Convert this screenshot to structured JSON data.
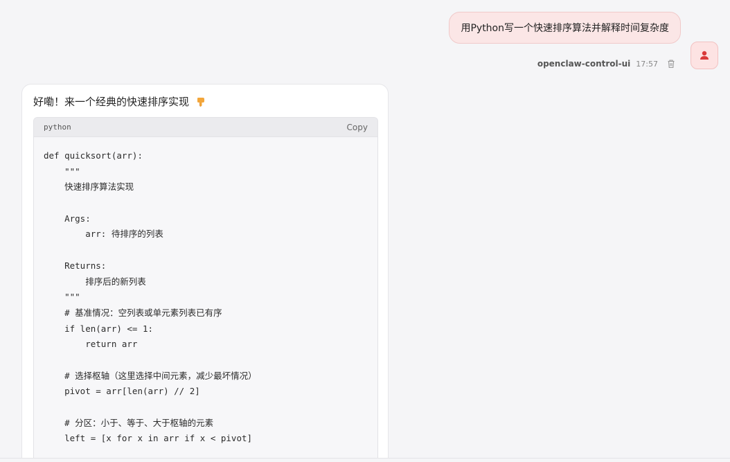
{
  "user_message": {
    "text": "用Python写一个快速排序算法并解释时间复杂度",
    "sender": "openclaw-control-ui",
    "time": "17:57",
    "avatar_icon": "user-icon",
    "delete_icon": "trash-icon"
  },
  "assistant_message": {
    "intro": "好嘞！来一个经典的快速排序实现",
    "intro_icon": "pointing-down-emoji",
    "code": {
      "language": "python",
      "copy_label": "Copy",
      "lines": [
        "def quicksort(arr):",
        "    \"\"\"",
        "    快速排序算法实现",
        "",
        "    Args:",
        "        arr: 待排序的列表",
        "",
        "    Returns:",
        "        排序后的新列表",
        "    \"\"\"",
        "    # 基准情况：空列表或单元素列表已有序",
        "    if len(arr) <= 1:",
        "        return arr",
        "",
        "    # 选择枢轴（这里选择中间元素，减少最坏情况）",
        "    pivot = arr[len(arr) // 2]",
        "",
        "    # 分区：小于、等于、大于枢轴的元素",
        "    left = [x for x in arr if x < pivot]"
      ]
    }
  },
  "colors": {
    "user_bubble_bg": "#fbe6e6",
    "avatar_icon": "#d93a3a",
    "page_bg": "#f5f5f7"
  }
}
